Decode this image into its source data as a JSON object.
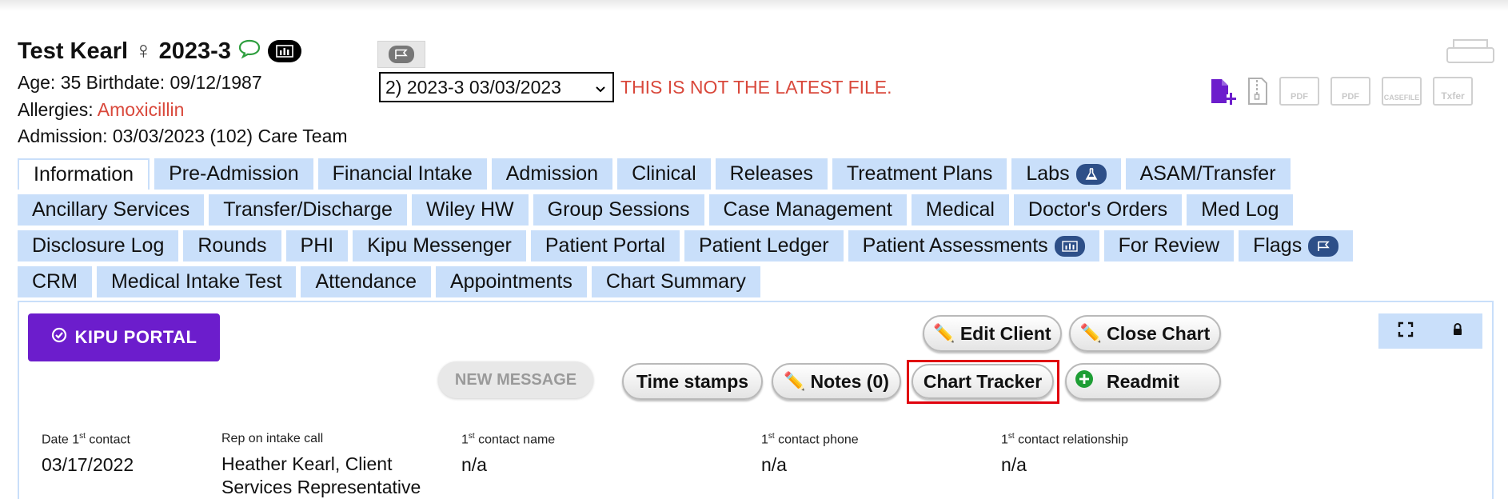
{
  "patient": {
    "name": "Test Kearl",
    "gender_symbol": "♀",
    "file_id": "2023-3",
    "age_line": "Age: 35   Birthdate: 09/12/1987",
    "allergies_label": "Allergies:",
    "allergies_value": "Amoxicillin",
    "admission_line": "Admission: 03/03/2023 (102)  Care Team"
  },
  "file_selector": {
    "selected": "2) 2023-3 03/03/2023",
    "warning": "THIS IS NOT THE LATEST FILE."
  },
  "doc_icons": {
    "pdf1": "PDF",
    "pdf2": "PDF",
    "casefile": "CASEFILE",
    "txfer": "Txfer"
  },
  "tabs": {
    "row1": [
      "Information",
      "Pre-Admission",
      "Financial Intake",
      "Admission",
      "Clinical",
      "Releases",
      "Treatment Plans",
      "Labs",
      "ASAM/Transfer"
    ],
    "row2": [
      "Ancillary Services",
      "Transfer/Discharge",
      "Wiley HW",
      "Group Sessions",
      "Case Management",
      "Medical",
      "Doctor's Orders",
      "Med Log"
    ],
    "row3": [
      "Disclosure Log",
      "Rounds",
      "PHI",
      "Kipu Messenger",
      "Patient Portal",
      "Patient Ledger",
      "Patient Assessments",
      "For Review",
      "Flags"
    ],
    "row4": [
      "CRM",
      "Medical Intake Test",
      "Attendance",
      "Appointments",
      "Chart Summary"
    ],
    "active": "Information"
  },
  "actions": {
    "kipu_portal": "KIPU PORTAL",
    "edit_client": "Edit Client",
    "close_chart": "Close Chart",
    "new_message": "NEW MESSAGE",
    "time_stamps": "Time stamps",
    "notes": "Notes (0)",
    "chart_tracker": "Chart Tracker",
    "readmit": "Readmit"
  },
  "fields": [
    {
      "label_pre": "Date 1",
      "sup": "st",
      "label_post": " contact",
      "value": "03/17/2022"
    },
    {
      "label_pre": "Rep on intake call",
      "sup": "",
      "label_post": "",
      "value": "Heather Kearl, Client Services Representative"
    },
    {
      "label_pre": "1",
      "sup": "st",
      "label_post": " contact name",
      "value": "n/a"
    },
    {
      "label_pre": "1",
      "sup": "st",
      "label_post": " contact phone",
      "value": "n/a"
    },
    {
      "label_pre": "1",
      "sup": "st",
      "label_post": " contact relationship",
      "value": "n/a"
    }
  ],
  "colors": {
    "tab_bg": "#c9dffa",
    "kipu_purple": "#6c1dcc",
    "warning_red": "#d9483b",
    "highlight_red": "#e0000d"
  }
}
